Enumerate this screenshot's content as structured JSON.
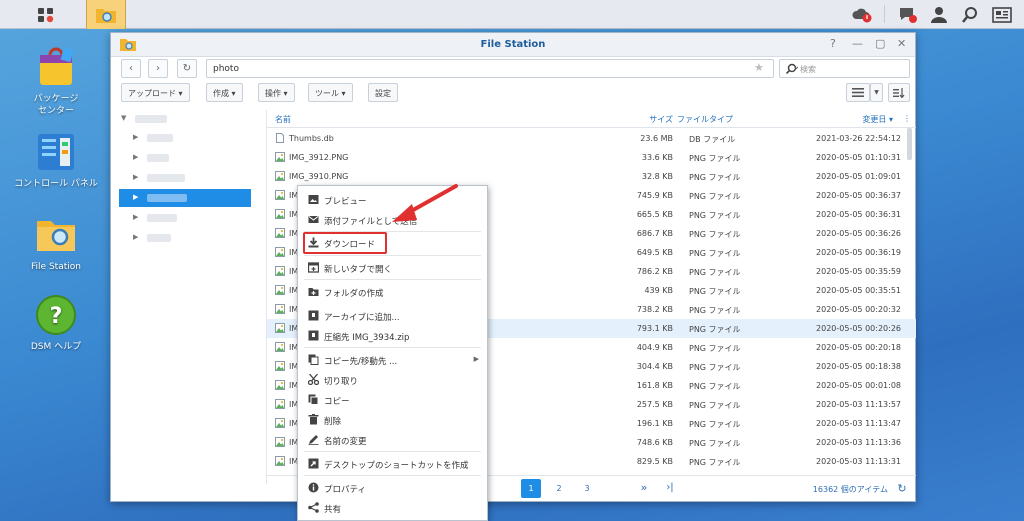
{
  "window": {
    "title": "File Station"
  },
  "desktop": [
    {
      "label_lines": [
        "パッケージ",
        "センター"
      ]
    },
    {
      "label_lines": [
        "コントロール パネル"
      ]
    },
    {
      "label_lines": [
        "File Station"
      ]
    },
    {
      "label_lines": [
        "DSM ヘルプ"
      ]
    }
  ],
  "nav": {
    "path": "photo",
    "search_placeholder": "検索"
  },
  "toolbar": {
    "upload": "アップロード",
    "create": "作成",
    "action": "操作",
    "tools": "ツール",
    "settings": "設定"
  },
  "columns": {
    "name": "名前",
    "size": "サイズ",
    "type": "ファイルタイプ",
    "modified": "変更日"
  },
  "files": [
    {
      "name": "Thumbs.db",
      "size": "23.6 MB",
      "type": "DB ファイル",
      "modified": "2021-03-26 22:54:12",
      "kind": "doc"
    },
    {
      "name": "IMG_3912.PNG",
      "size": "33.6 KB",
      "type": "PNG ファイル",
      "modified": "2020-05-05 01:10:31",
      "kind": "img"
    },
    {
      "name": "IMG_3910.PNG",
      "size": "32.8 KB",
      "type": "PNG ファイル",
      "modified": "2020-05-05 01:09:01",
      "kind": "img"
    },
    {
      "name": "IMG",
      "size": "745.9 KB",
      "type": "PNG ファイル",
      "modified": "2020-05-05 00:36:37",
      "kind": "img"
    },
    {
      "name": "IMG",
      "size": "665.5 KB",
      "type": "PNG ファイル",
      "modified": "2020-05-05 00:36:31",
      "kind": "img"
    },
    {
      "name": "IMG",
      "size": "686.7 KB",
      "type": "PNG ファイル",
      "modified": "2020-05-05 00:36:26",
      "kind": "img"
    },
    {
      "name": "IMG",
      "size": "649.5 KB",
      "type": "PNG ファイル",
      "modified": "2020-05-05 00:36:19",
      "kind": "img"
    },
    {
      "name": "IMG",
      "size": "786.2 KB",
      "type": "PNG ファイル",
      "modified": "2020-05-05 00:35:59",
      "kind": "img"
    },
    {
      "name": "IMG",
      "size": "439 KB",
      "type": "PNG ファイル",
      "modified": "2020-05-05 00:35:51",
      "kind": "img"
    },
    {
      "name": "IMG",
      "size": "738.2 KB",
      "type": "PNG ファイル",
      "modified": "2020-05-05 00:20:32",
      "kind": "img"
    },
    {
      "name": "IMG",
      "size": "793.1 KB",
      "type": "PNG ファイル",
      "modified": "2020-05-05 00:20:26",
      "kind": "img",
      "selected": true
    },
    {
      "name": "IMG",
      "size": "404.9 KB",
      "type": "PNG ファイル",
      "modified": "2020-05-05 00:20:18",
      "kind": "img"
    },
    {
      "name": "IMG",
      "size": "304.4 KB",
      "type": "PNG ファイル",
      "modified": "2020-05-05 00:18:38",
      "kind": "img"
    },
    {
      "name": "IMG",
      "size": "161.8 KB",
      "type": "PNG ファイル",
      "modified": "2020-05-05 00:01:08",
      "kind": "img"
    },
    {
      "name": "IMG",
      "size": "257.5 KB",
      "type": "PNG ファイル",
      "modified": "2020-05-03 11:13:57",
      "kind": "img"
    },
    {
      "name": "IMG",
      "size": "196.1 KB",
      "type": "PNG ファイル",
      "modified": "2020-05-03 11:13:47",
      "kind": "img"
    },
    {
      "name": "IMG",
      "size": "748.6 KB",
      "type": "PNG ファイル",
      "modified": "2020-05-03 11:13:36",
      "kind": "img"
    },
    {
      "name": "IMG",
      "size": "829.5 KB",
      "type": "PNG ファイル",
      "modified": "2020-05-03 11:13:31",
      "kind": "img"
    }
  ],
  "pager": {
    "pages": [
      "1",
      "2",
      "3"
    ],
    "current": "1",
    "count": "16362 個のアイテム"
  },
  "context_menu": [
    {
      "label": "プレビュー",
      "icon": "image-icon"
    },
    {
      "label": "添付ファイルとして送信",
      "icon": "mail-icon"
    },
    {
      "label": "ダウンロード",
      "icon": "download-icon"
    },
    {
      "label": "新しいタブで開く",
      "icon": "new-tab-icon"
    },
    {
      "label": "フォルダの作成",
      "icon": "new-folder-icon"
    },
    {
      "label": "アーカイブに追加...",
      "icon": "archive-icon"
    },
    {
      "label": "圧縮先 IMG_3934.zip",
      "icon": "zip-icon"
    },
    {
      "label": "コピー先/移動先 ...",
      "icon": "copy-move-icon",
      "submenu": true
    },
    {
      "label": "切り取り",
      "icon": "cut-icon"
    },
    {
      "label": "コピー",
      "icon": "copy-icon"
    },
    {
      "label": "削除",
      "icon": "trash-icon"
    },
    {
      "label": "名前の変更",
      "icon": "rename-icon"
    },
    {
      "label": "デスクトップのショートカットを作成",
      "icon": "shortcut-icon"
    },
    {
      "label": "プロパティ",
      "icon": "info-icon"
    },
    {
      "label": "共有",
      "icon": "share-icon"
    }
  ],
  "colors": {
    "accent": "#1f8ce6",
    "highlight": "#e03030",
    "link": "#1f6fbf"
  }
}
